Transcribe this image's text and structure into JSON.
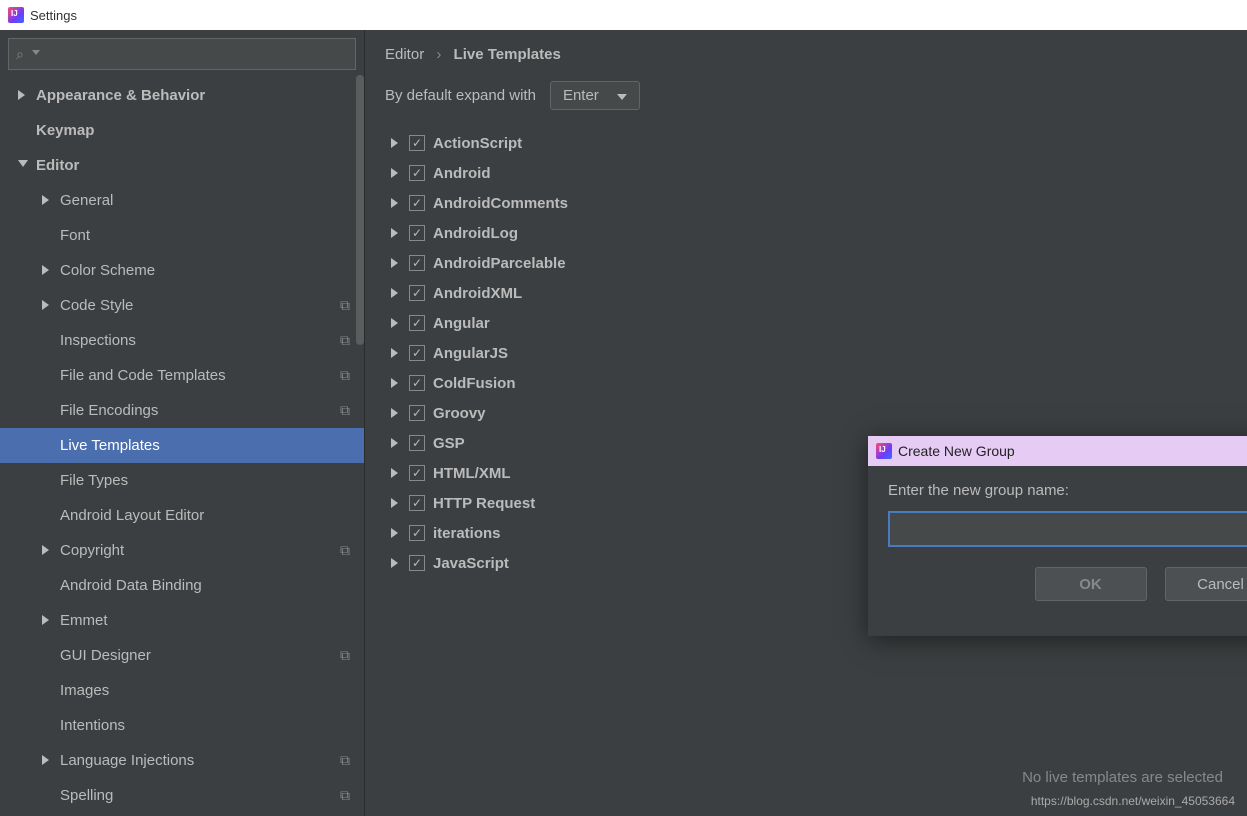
{
  "window": {
    "title": "Settings"
  },
  "sidebar": {
    "items": [
      {
        "label": "Appearance & Behavior",
        "depth": 0,
        "arrow": "right",
        "bold": true
      },
      {
        "label": "Keymap",
        "depth": 0,
        "arrow": "",
        "bold": true
      },
      {
        "label": "Editor",
        "depth": 0,
        "arrow": "down",
        "bold": true
      },
      {
        "label": "General",
        "depth": 1,
        "arrow": "right"
      },
      {
        "label": "Font",
        "depth": 1,
        "arrow": ""
      },
      {
        "label": "Color Scheme",
        "depth": 1,
        "arrow": "right"
      },
      {
        "label": "Code Style",
        "depth": 1,
        "arrow": "right",
        "copy": true
      },
      {
        "label": "Inspections",
        "depth": 1,
        "arrow": "",
        "copy": true
      },
      {
        "label": "File and Code Templates",
        "depth": 1,
        "arrow": "",
        "copy": true
      },
      {
        "label": "File Encodings",
        "depth": 1,
        "arrow": "",
        "copy": true
      },
      {
        "label": "Live Templates",
        "depth": 1,
        "arrow": "",
        "selected": true
      },
      {
        "label": "File Types",
        "depth": 1,
        "arrow": ""
      },
      {
        "label": "Android Layout Editor",
        "depth": 1,
        "arrow": ""
      },
      {
        "label": "Copyright",
        "depth": 1,
        "arrow": "right",
        "copy": true
      },
      {
        "label": "Android Data Binding",
        "depth": 1,
        "arrow": ""
      },
      {
        "label": "Emmet",
        "depth": 1,
        "arrow": "right"
      },
      {
        "label": "GUI Designer",
        "depth": 1,
        "arrow": "",
        "copy": true
      },
      {
        "label": "Images",
        "depth": 1,
        "arrow": ""
      },
      {
        "label": "Intentions",
        "depth": 1,
        "arrow": ""
      },
      {
        "label": "Language Injections",
        "depth": 1,
        "arrow": "right",
        "copy": true
      },
      {
        "label": "Spelling",
        "depth": 1,
        "arrow": "",
        "copy": true
      }
    ]
  },
  "breadcrumb": {
    "seg1": "Editor",
    "sep": "›",
    "seg2": "Live Templates"
  },
  "expand": {
    "label": "By default expand with",
    "value": "Enter"
  },
  "templates": [
    "ActionScript",
    "Android",
    "AndroidComments",
    "AndroidLog",
    "AndroidParcelable",
    "AndroidXML",
    "Angular",
    "AngularJS",
    "ColdFusion",
    "Groovy",
    "GSP",
    "HTML/XML",
    "HTTP Request",
    "iterations",
    "JavaScript"
  ],
  "status": "No live templates are selected",
  "watermark": "https://blog.csdn.net/weixin_45053664",
  "dialog": {
    "title": "Create New Group",
    "label": "Enter the new group name:",
    "ok": "OK",
    "cancel": "Cancel",
    "value": ""
  }
}
